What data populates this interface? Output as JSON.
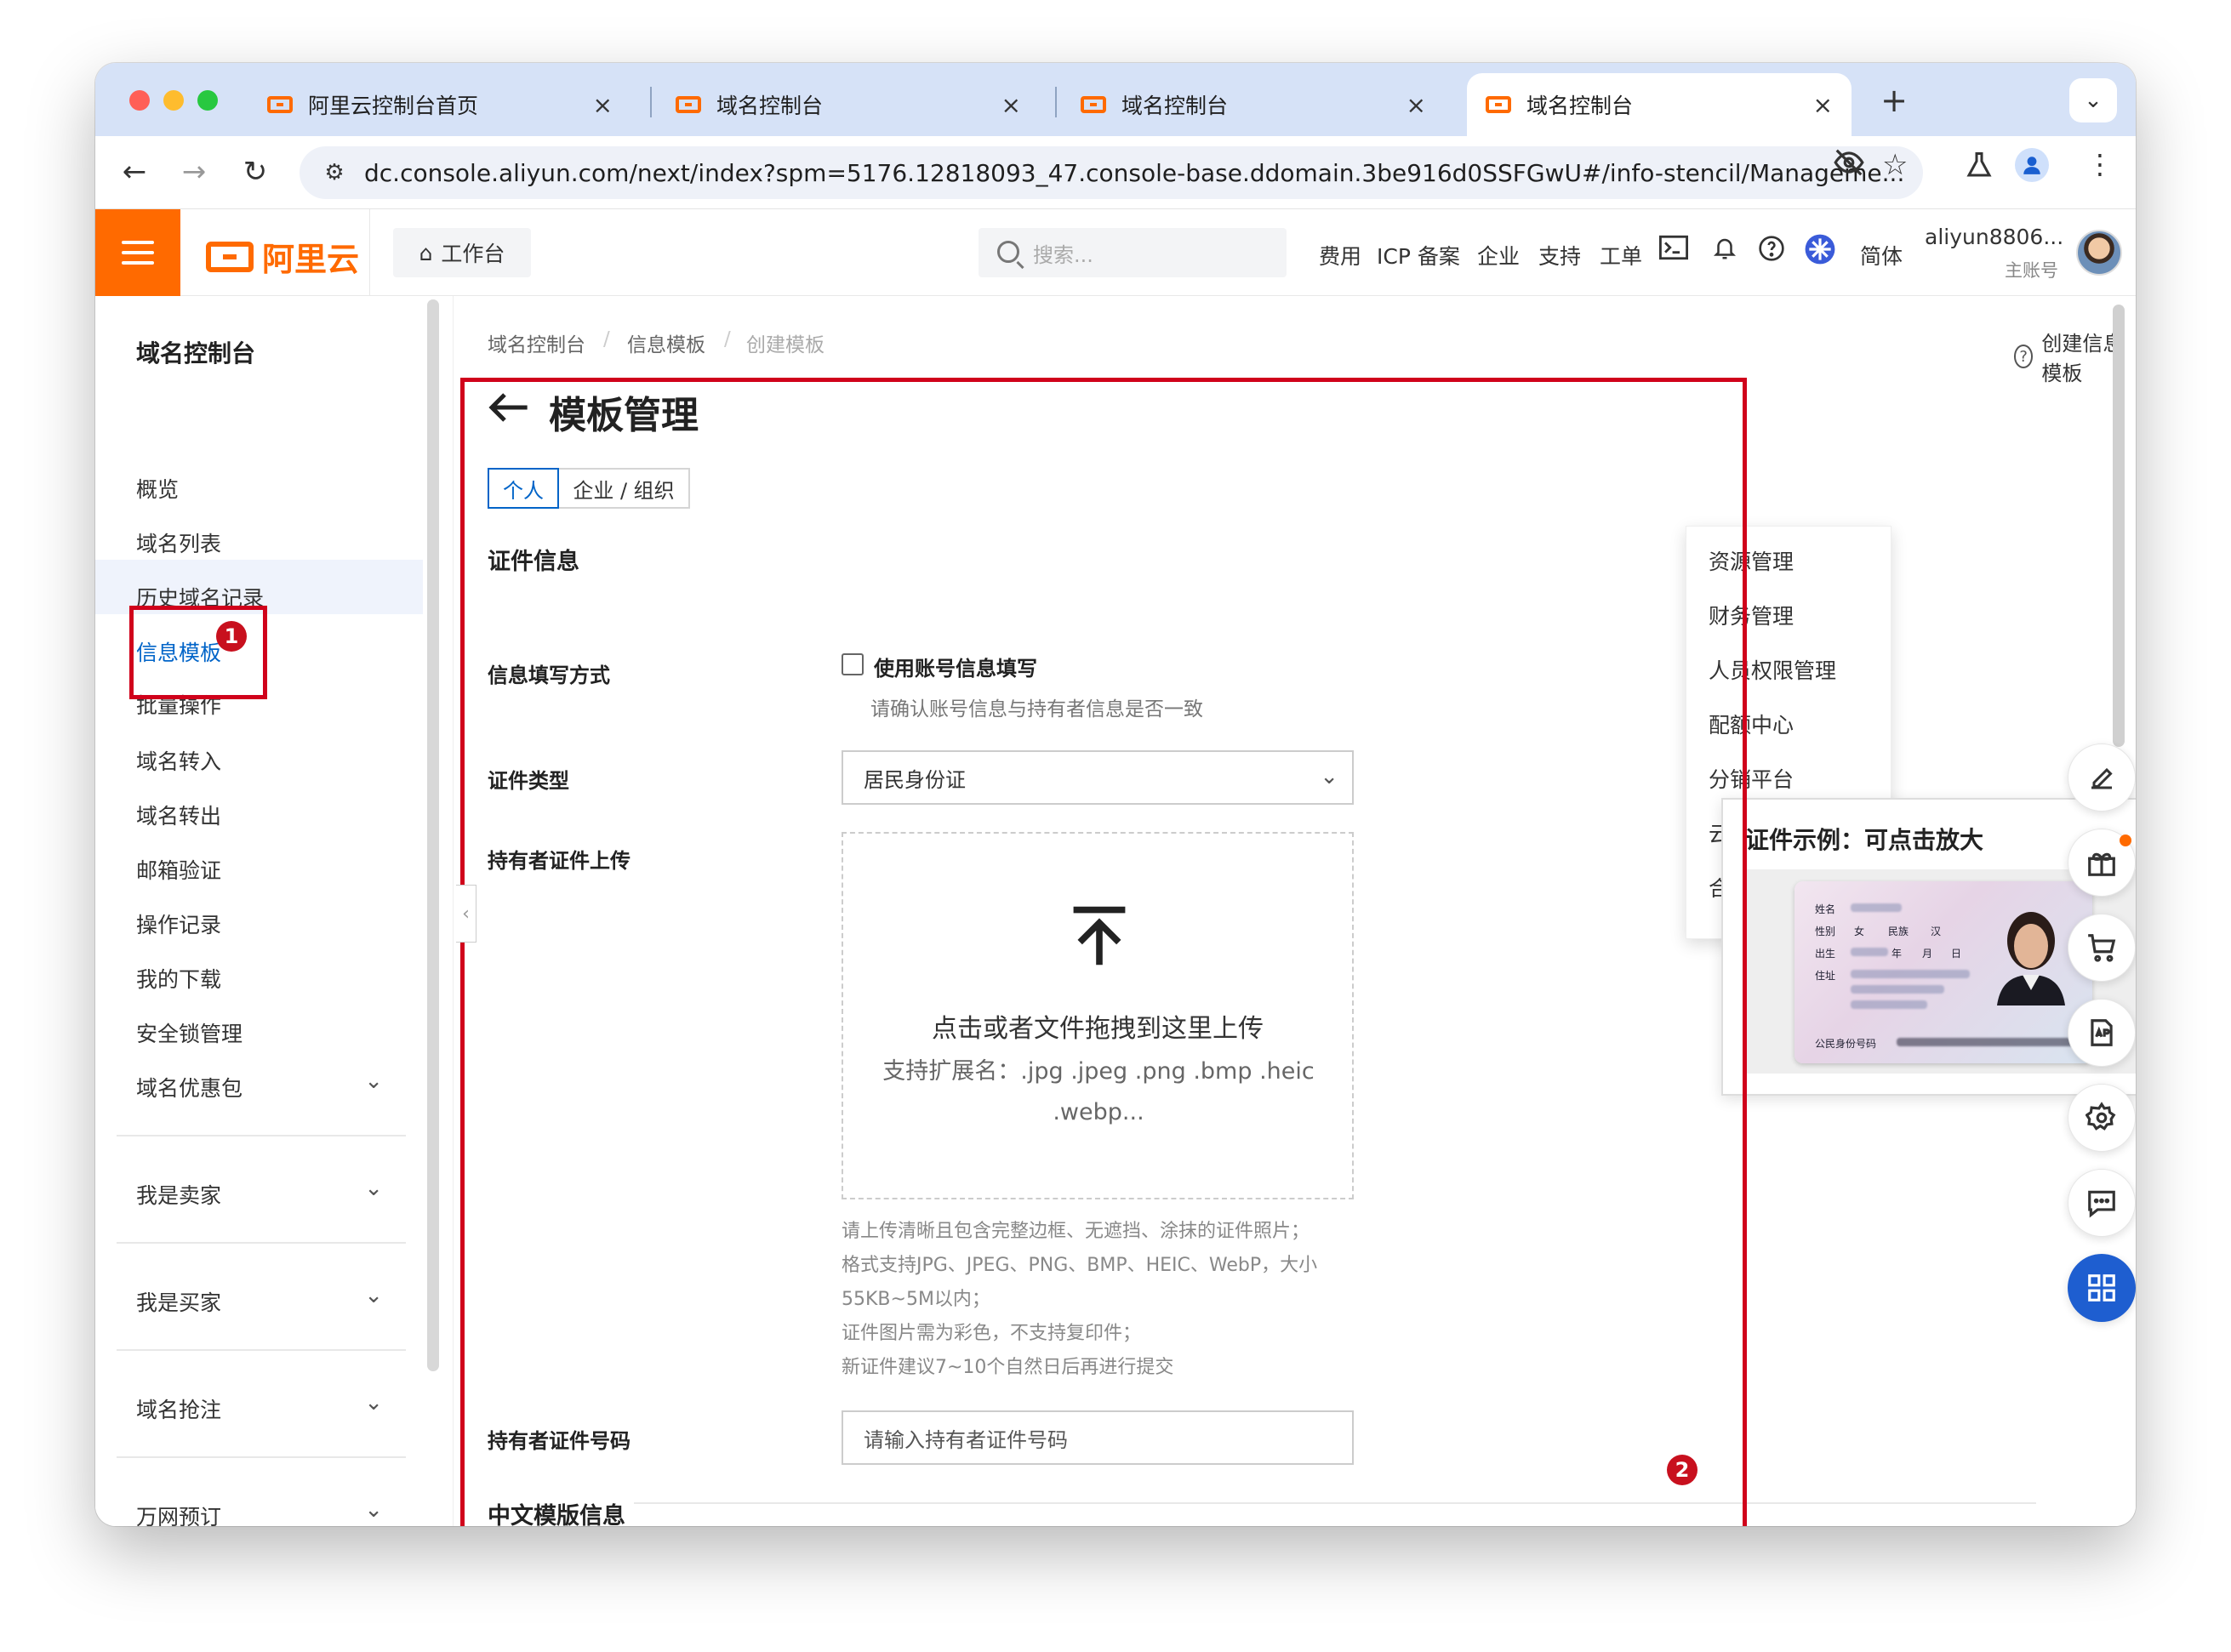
{
  "browser": {
    "tabs": [
      {
        "title": "阿里云控制台首页",
        "active": false
      },
      {
        "title": "域名控制台",
        "active": false
      },
      {
        "title": "域名控制台",
        "active": false
      },
      {
        "title": "域名控制台",
        "active": true
      }
    ],
    "url": "dc.console.aliyun.com/next/index?spm=5176.12818093_47.console-base.ddomain.3be916d0SSFGwU#/info-stencil/Manageme..."
  },
  "header": {
    "logo_text": "阿里云",
    "workbench_label": "工作台",
    "search_placeholder": "搜索...",
    "nav": [
      "费用",
      "ICP 备案",
      "企业",
      "支持",
      "工单"
    ],
    "lang": "简体",
    "user_name": "aliyun8806...",
    "user_role": "主账号"
  },
  "sidebar": {
    "title": "域名控制台",
    "items": [
      "概览",
      "域名列表",
      "历史域名记录",
      "信息模板",
      "批量操作",
      "域名转入",
      "域名转出",
      "邮箱验证",
      "操作记录",
      "我的下载",
      "安全锁管理"
    ],
    "active_item": "信息模板",
    "groups": [
      "域名优惠包",
      "我是卖家",
      "我是买家",
      "域名抢注",
      "万网预订"
    ]
  },
  "breadcrumb": [
    "域名控制台",
    "信息模板",
    "创建模板"
  ],
  "page": {
    "title": "模板管理",
    "help_link": "创建信息模板",
    "segments": [
      "个人",
      "企业 / 组织"
    ],
    "section_title": "证件信息",
    "fill_method_label": "信息填写方式",
    "use_account_label": "使用账号信息填写",
    "use_account_hint": "请确认账号信息与持有者信息是否一致",
    "cert_type_label": "证件类型",
    "cert_type_value": "居民身份证",
    "upload_label": "持有者证件上传",
    "upload_main": "点击或者文件拖拽到这里上传",
    "upload_sub": "支持扩展名：.jpg .jpeg .png .bmp .heic .webp...",
    "notes": [
      "请上传清晰且包含完整边框、无遮挡、涂抹的证件照片；",
      "格式支持JPG、JPEG、PNG、BMP、HEIC、WebP，大小55KB~5M以内；",
      "证件图片需为彩色，不支持复印件；",
      "新证件建议7~10个自然日后再进行提交"
    ],
    "id_number_label": "持有者证件号码",
    "id_number_placeholder": "请输入持有者证件号码",
    "section2_title": "中文模版信息"
  },
  "dropdown": {
    "items": [
      "资源管理",
      "财务管理",
      "人员权限管理",
      "配额中心",
      "分销平台",
      "云",
      "合"
    ]
  },
  "popover": {
    "title": "证件示例：可点击放大",
    "card_labels": {
      "name": "姓名",
      "gender": "性别",
      "gender_value": "女",
      "ethnicity": "民族",
      "ethnicity_value": "汉",
      "birth": "出生",
      "year": "年",
      "month": "月",
      "day": "日",
      "address": "住址",
      "id_number": "公民身份号码"
    }
  },
  "annotations": {
    "badge1": "1",
    "badge2": "2",
    "color": "#d0021b"
  },
  "floating_tools": [
    "edit-icon",
    "gift-icon",
    "cart-icon",
    "app-icon",
    "settings-icon",
    "chat-icon",
    "grid-icon"
  ]
}
